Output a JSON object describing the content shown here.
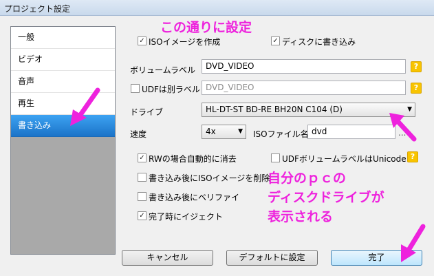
{
  "window": {
    "title": "プロジェクト設定"
  },
  "nav": {
    "items": [
      {
        "label": "一般"
      },
      {
        "label": "ビデオ"
      },
      {
        "label": "音声"
      },
      {
        "label": "再生"
      },
      {
        "label": "書き込み"
      }
    ],
    "selected": "書き込み"
  },
  "annotations": {
    "top": "この通りに設定",
    "side_line1": "自分のｐｃの",
    "side_line2": "ディスクドライブが",
    "side_line3": "表示される",
    "color": "#ee22dd"
  },
  "options": {
    "create_iso": {
      "label": "ISOイメージを作成",
      "checked": true
    },
    "write_disc": {
      "label": "ディスクに書き込み",
      "checked": true
    }
  },
  "volume_label": {
    "label": "ボリュームラベル",
    "value": "DVD_VIDEO",
    "help": "?"
  },
  "udf_label": {
    "checkbox_label": "UDFは別ラベル",
    "checked": false,
    "value": "DVD_VIDEO",
    "help": "?"
  },
  "drive": {
    "label": "ドライブ",
    "value": "HL-DT-ST BD-RE  BH20N C104 (D)"
  },
  "speed": {
    "label": "速度",
    "value": "4x"
  },
  "iso_file": {
    "label": "ISOファイル名",
    "value": "dvd",
    "browse": "..."
  },
  "checkboxes": {
    "rw_erase": {
      "label": "RWの場合自動的に消去",
      "checked": true
    },
    "udf_unicode": {
      "label": "UDFボリュームラベルはUnicode",
      "checked": false,
      "help": "?"
    },
    "delete_iso": {
      "label": "書き込み後にISOイメージを削除",
      "checked": false
    },
    "verify": {
      "label": "書き込み後にベリファイ",
      "checked": false
    },
    "eject": {
      "label": "完了時にイジェクト",
      "checked": true
    }
  },
  "buttons": {
    "cancel": "キャンセル",
    "set_default": "デフォルトに設定",
    "done": "完了"
  }
}
